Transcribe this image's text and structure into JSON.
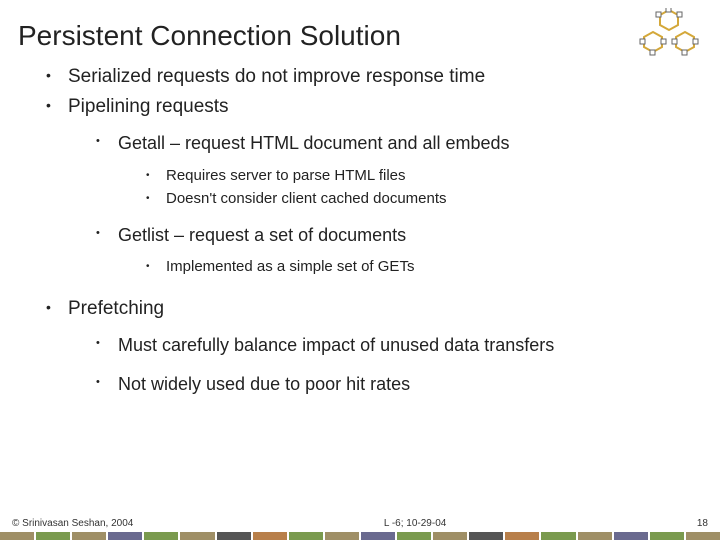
{
  "title": "Persistent Connection Solution",
  "bullets": {
    "b1_1": "Serialized requests do not improve response time",
    "b1_2": "Pipelining requests",
    "b2_1": "Getall – request HTML document and all embeds",
    "b3_1": "Requires server to parse HTML files",
    "b3_2": "Doesn't consider client cached documents",
    "b2_2": "Getlist – request a set of documents",
    "b3_3": "Implemented as a simple set of GETs",
    "b1_3": "Prefetching",
    "b2_3": "Must carefully balance impact of unused data transfers",
    "b2_4": "Not widely used due to poor hit rates"
  },
  "footer": {
    "left": "© Srinivasan Seshan, 2004",
    "center": "L -6; 10-29-04",
    "right": "18"
  }
}
